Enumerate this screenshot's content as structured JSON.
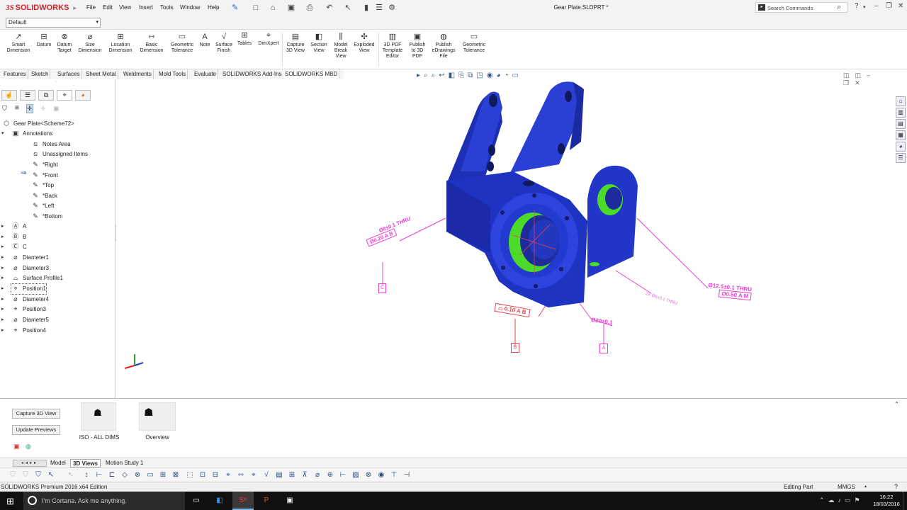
{
  "app": {
    "brand": "SOLIDWORKS",
    "document_title": "Gear Plate.SLDPRT *",
    "menus": [
      "File",
      "Edit",
      "View",
      "Insert",
      "Tools",
      "Window",
      "Help"
    ],
    "search_placeholder": "Search Commands"
  },
  "config": {
    "selected": "Default"
  },
  "ribbon": {
    "buttons": [
      {
        "label": "Smart Dimension",
        "icon": "smart-dimension-icon"
      },
      {
        "label": "Datum",
        "icon": "datum-icon"
      },
      {
        "label": "Datum Target",
        "icon": "datum-target-icon"
      },
      {
        "label": "Size Dimension",
        "icon": "size-dimension-icon"
      },
      {
        "label": "Location Dimension",
        "icon": "location-dimension-icon"
      },
      {
        "label": "Basic Dimension",
        "icon": "basic-dimension-icon"
      },
      {
        "label": "Geometric Tolerance",
        "icon": "geometric-tolerance-icon"
      },
      {
        "label": "Note",
        "icon": "note-icon"
      },
      {
        "label": "Surface Finish",
        "icon": "surface-finish-icon"
      },
      {
        "label": "Tables",
        "icon": "tables-icon"
      },
      {
        "label": "DimXpert",
        "icon": "dimxpert-icon"
      },
      {
        "label": "Capture 3D View",
        "icon": "capture-3d-view-icon"
      },
      {
        "label": "Section View",
        "icon": "section-view-icon"
      },
      {
        "label": "Model Break View",
        "icon": "model-break-view-icon"
      },
      {
        "label": "Exploded View",
        "icon": "exploded-view-icon"
      },
      {
        "label": "3D PDF Template Editor",
        "icon": "3d-pdf-template-editor-icon"
      },
      {
        "label": "Publish to 3D PDF",
        "icon": "publish-3d-pdf-icon"
      },
      {
        "label": "Publish eDrawings File",
        "icon": "publish-edrawings-icon"
      },
      {
        "label": "Geometric Tolerance",
        "icon": "geometric-tolerance-2-icon"
      }
    ]
  },
  "command_tabs": [
    "Features",
    "Sketch",
    "Surfaces",
    "Sheet Metal",
    "Weldments",
    "Mold Tools",
    "Evaluate",
    "SOLIDWORKS Add-Ins",
    "SOLIDWORKS MBD"
  ],
  "feature_tree": {
    "root": "Gear Plate<Scheme72>",
    "annotations": {
      "label": "Annotations",
      "children": [
        "Notes Area",
        "Unassigned Items",
        "*Right",
        "*Front",
        "*Top",
        "*Back",
        "*Left",
        "*Bottom"
      ]
    },
    "items": [
      "A",
      "B",
      "C",
      "Diameter1",
      "Diameter3",
      "Surface Profile1",
      "Position1",
      "Diameter4",
      "Position3",
      "Diameter5",
      "Position4"
    ]
  },
  "annotations_3d": {
    "callout_top_left_1": "Ø8±0.1 THRU",
    "callout_top_left_2": "Ø0.20 A B",
    "datum_c": "C",
    "profile_tol": "0.10 A B",
    "datum_b": "B",
    "dia_20": "Ø20±0.1",
    "datum_a": "A",
    "callout_right_1": "Ø12.5±0.1 THRU",
    "callout_right_2": "Ø0.50 A M",
    "callout_right_back": "2X Ø6±0.1 THRU"
  },
  "views_pane": {
    "capture_button": "Capture 3D View",
    "update_button": "Update Previews",
    "views": [
      {
        "label": "ISO - ALL DIMS"
      },
      {
        "label": "Overview"
      }
    ]
  },
  "bottom_tabs": [
    "Model",
    "3D Views",
    "Motion Study 1"
  ],
  "status": {
    "edition": "SOLIDWORKS Premium 2016 x64 Edition",
    "mode": "Editing Part",
    "units": "MMGS"
  },
  "taskbar": {
    "cortana": "I'm Cortana. Ask me anything.",
    "time": "16:22",
    "date": "18/03/2016"
  },
  "colors": {
    "part_blue": "#2136c9",
    "bore_green": "#4ddb2a",
    "annotation_magenta": "#e83fd0",
    "annotation_red": "#e8454d",
    "brand_red": "#d2232a"
  }
}
